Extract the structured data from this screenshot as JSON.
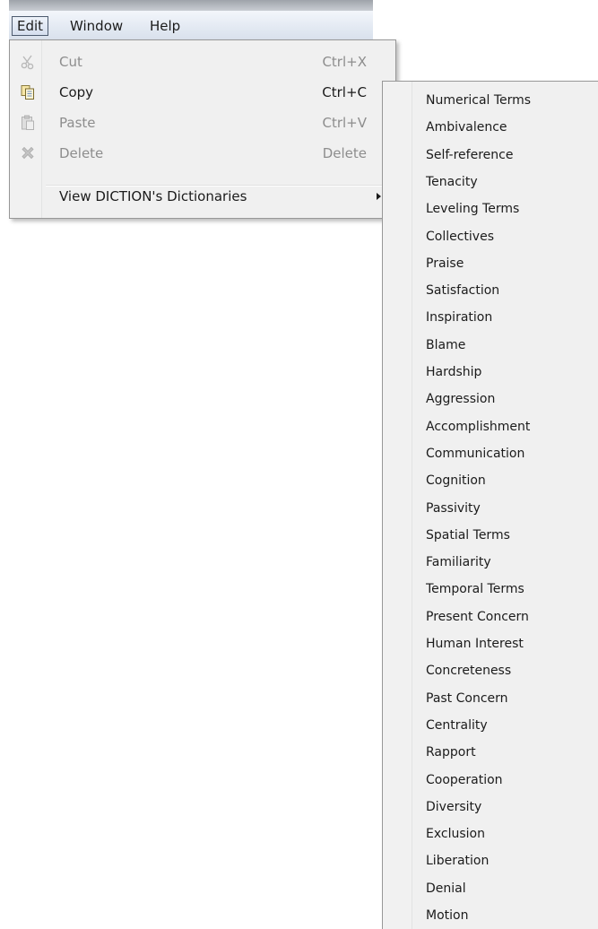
{
  "menubar": {
    "items": [
      {
        "label": "Edit"
      },
      {
        "label": "Window"
      },
      {
        "label": "Help"
      }
    ]
  },
  "edit_menu": {
    "items": [
      {
        "label": "Cut",
        "shortcut": "Ctrl+X",
        "icon": "scissors-icon",
        "enabled": false
      },
      {
        "label": "Copy",
        "shortcut": "Ctrl+C",
        "icon": "copy-icon",
        "enabled": true
      },
      {
        "label": "Paste",
        "shortcut": "Ctrl+V",
        "icon": "paste-icon",
        "enabled": false
      },
      {
        "label": "Delete",
        "shortcut": "Delete",
        "icon": "delete-icon",
        "enabled": false
      }
    ],
    "submenu_label": "View DICTION's Dictionaries"
  },
  "dictionaries": {
    "items": [
      "Numerical Terms",
      "Ambivalence",
      "Self-reference",
      "Tenacity",
      "Leveling Terms",
      "Collectives",
      "Praise",
      "Satisfaction",
      "Inspiration",
      "Blame",
      "Hardship",
      "Aggression",
      "Accomplishment",
      "Communication",
      "Cognition",
      "Passivity",
      "Spatial Terms",
      "Familiarity",
      "Temporal Terms",
      "Present Concern",
      "Human Interest",
      "Concreteness",
      "Past Concern",
      "Centrality",
      "Rapport",
      "Cooperation",
      "Diversity",
      "Exclusion",
      "Liberation",
      "Denial",
      "Motion"
    ]
  },
  "colors": {
    "menu_background": "#f0f0f0",
    "disabled_text": "#8d8d8d",
    "text": "#1b1b1b"
  }
}
